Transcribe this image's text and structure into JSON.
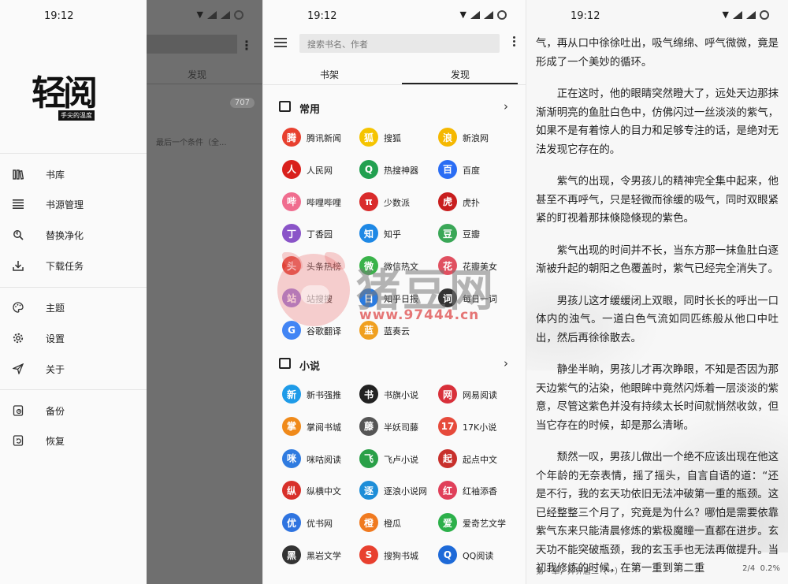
{
  "status": {
    "time": "19:12"
  },
  "drawer": {
    "logo": "轻阅",
    "logo_tagline": "手尖的温度",
    "menu": [
      {
        "id": "library",
        "label": "书库",
        "icon": "library-icon"
      },
      {
        "id": "sources",
        "label": "书源管理",
        "icon": "list-icon"
      },
      {
        "id": "replace",
        "label": "替换净化",
        "icon": "replace-icon"
      },
      {
        "id": "downloads",
        "label": "下载任务",
        "icon": "download-icon"
      },
      {
        "id": "theme",
        "label": "主题",
        "icon": "palette-icon"
      },
      {
        "id": "settings",
        "label": "设置",
        "icon": "gear-icon"
      },
      {
        "id": "about",
        "label": "关于",
        "icon": "send-icon"
      },
      {
        "id": "backup",
        "label": "备份",
        "icon": "backup-icon"
      },
      {
        "id": "restore",
        "label": "恢复",
        "icon": "restore-icon"
      }
    ],
    "background": {
      "tab": "发现",
      "badge": "707",
      "text": "最后一个条件（全..."
    }
  },
  "discover": {
    "search_placeholder": "搜索书名、作者",
    "tabs": [
      "书架",
      "发现"
    ],
    "sections": [
      {
        "title": "常用",
        "items": [
          {
            "label": "腾讯新闻",
            "color": "#e8402f",
            "glyph": "腾"
          },
          {
            "label": "搜狐",
            "color": "#f5c400",
            "glyph": "狐"
          },
          {
            "label": "新浪网",
            "color": "#f5b800",
            "glyph": "浪"
          },
          {
            "label": "人民网",
            "color": "#d9201c",
            "glyph": "人"
          },
          {
            "label": "热搜神器",
            "color": "#22a050",
            "glyph": "Q"
          },
          {
            "label": "百度",
            "color": "#2a6df4",
            "glyph": "百"
          },
          {
            "label": "哔哩哔哩",
            "color": "#f06d8f",
            "glyph": "哔"
          },
          {
            "label": "少数派",
            "color": "#d92b2b",
            "glyph": "π"
          },
          {
            "label": "虎扑",
            "color": "#c81e1e",
            "glyph": "虎"
          },
          {
            "label": "丁香园",
            "color": "#8a54c8",
            "glyph": "丁"
          },
          {
            "label": "知乎",
            "color": "#1e88e5",
            "glyph": "知"
          },
          {
            "label": "豆瓣",
            "color": "#3aa757",
            "glyph": "豆"
          },
          {
            "label": "头条热榜",
            "color": "#e0453a",
            "glyph": "头"
          },
          {
            "label": "微信热文",
            "color": "#3ab34a",
            "glyph": "微"
          },
          {
            "label": "花瓣美女",
            "color": "#e05060",
            "glyph": "花"
          },
          {
            "label": "站搜搜",
            "color": "#9a7ad8",
            "glyph": "站"
          },
          {
            "label": "知乎日报",
            "color": "#2a7be0",
            "glyph": "日"
          },
          {
            "label": "每日一词",
            "color": "#333333",
            "glyph": "词"
          },
          {
            "label": "谷歌翻译",
            "color": "#4285f4",
            "glyph": "G"
          },
          {
            "label": "蓝奏云",
            "color": "#f0a020",
            "glyph": "蓝"
          }
        ]
      },
      {
        "title": "小说",
        "items": [
          {
            "label": "新书强推",
            "color": "#1e9be8",
            "glyph": "新"
          },
          {
            "label": "书旗小说",
            "color": "#222222",
            "glyph": "书"
          },
          {
            "label": "网易阅读",
            "color": "#d8303a",
            "glyph": "网"
          },
          {
            "label": "掌阅书城",
            "color": "#f08a1a",
            "glyph": "掌"
          },
          {
            "label": "半妖司藤",
            "color": "#555555",
            "glyph": "藤"
          },
          {
            "label": "17K小说",
            "color": "#e64a3b",
            "glyph": "17"
          },
          {
            "label": "咪咕阅读",
            "color": "#2f7be0",
            "glyph": "咪"
          },
          {
            "label": "飞卢小说",
            "color": "#2aa048",
            "glyph": "飞"
          },
          {
            "label": "起点中文",
            "color": "#c8302c",
            "glyph": "起"
          },
          {
            "label": "纵横中文",
            "color": "#d8302a",
            "glyph": "纵"
          },
          {
            "label": "逐浪小说网",
            "color": "#1e8ed8",
            "glyph": "逐"
          },
          {
            "label": "红袖添香",
            "color": "#e0405a",
            "glyph": "红"
          },
          {
            "label": "优书网",
            "color": "#2f74e0",
            "glyph": "优"
          },
          {
            "label": "橙瓜",
            "color": "#f07a20",
            "glyph": "橙"
          },
          {
            "label": "爱奇艺文学",
            "color": "#2cb04a",
            "glyph": "爱"
          },
          {
            "label": "黑岩文学",
            "color": "#333333",
            "glyph": "黑"
          },
          {
            "label": "搜狗书城",
            "color": "#e8402f",
            "glyph": "S"
          },
          {
            "label": "QQ阅读",
            "color": "#1e6ad8",
            "glyph": "Q"
          }
        ]
      }
    ]
  },
  "reader": {
    "paragraphs": [
      "气，再从口中徐徐吐出，吸气绵绵、呼气微微，竟是形成了一个美妙的循环。",
      "正在这时，他的眼睛突然瞪大了，远处天边那抹渐渐明亮的鱼肚白色中，仿佛闪过一丝淡淡的紫气，如果不是有着惊人的目力和足够专注的话，是绝对无法发现它存在的。",
      "紫气的出现，令男孩儿的精神完全集中起来，他甚至不再呼气，只是轻微而徐缓的吸气，同时双眼紧紧的盯视着那抹倏隐倏现的紫色。",
      "紫气出现的时间并不长，当东方那一抹鱼肚白逐渐被升起的朝阳之色覆盖时，紫气已经完全消失了。",
      "男孩儿这才缓缓闭上双眼，同时长长的呼出一口体内的浊气。一道白色气流如同匹练般从他口中吐出，然后再徐徐散去。",
      "静坐半晌，男孩儿才再次睁眼，不知是否因为那天边紫气的沾染，他眼眸中竟然闪烁着一层淡淡的紫意，尽管这紫色并没有持续太长时间就悄然收敛，但当它存在的时候，却是那么清晰。",
      "颓然一叹，男孩儿做出一个绝不应该出现在他这个年龄的无奈表情，摇了摇头，自言自语的道：“还是不行，我的玄天功依旧无法冲破第一重的瓶颈。这已经整整三个月了，究竟是为什么？哪怕是需要依靠紫气东来只能清晨修炼的紫极魔瞳一直都在进步。玄天功不能突破瓶颈，我的玄玉手也无法再做提升。当初我修炼的时候，在第一重到第二重"
    ],
    "chapter": "第一章，异界唐三（一）",
    "page": "2/4",
    "progress": "0.2%"
  },
  "watermark": {
    "text": "猪豆网",
    "url": "www.97444.cn"
  }
}
